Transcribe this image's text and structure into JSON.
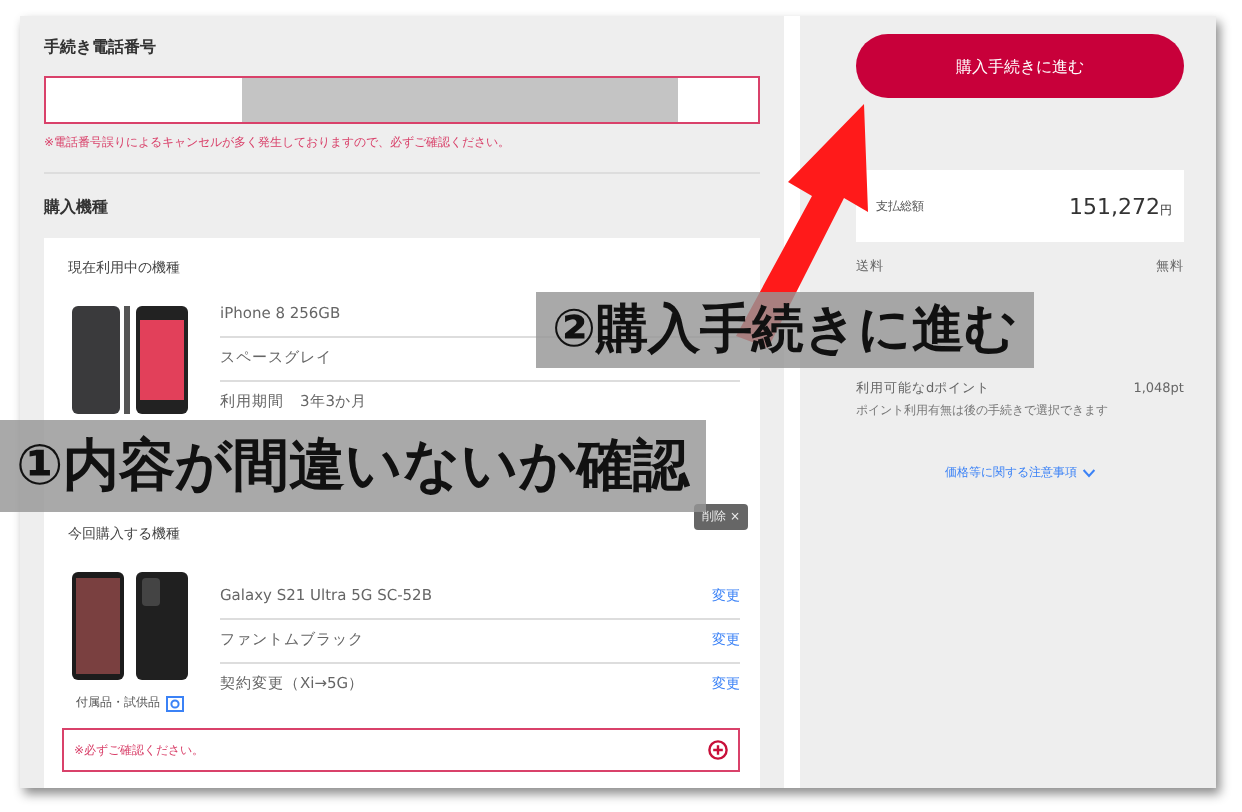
{
  "phone_section": {
    "title": "手続き電話番号",
    "warning": "※電話番号誤りによるキャンセルが多く発生しておりますので、必ずご確認ください。"
  },
  "device_section": {
    "title": "購入機種",
    "current": {
      "title": "現在利用中の機種",
      "specs": [
        "iPhone 8 256GB",
        "スペースグレイ",
        "利用期間　3年3か月"
      ]
    },
    "new": {
      "title": "今回購入する機種",
      "remove": "削除 ×",
      "specs": [
        {
          "text": "Galaxy S21 Ultra 5G SC-52B",
          "action": "変更"
        },
        {
          "text": "ファントムブラック",
          "action": "変更"
        },
        {
          "text": "契約変更（Xi→5G）",
          "action": "変更"
        }
      ],
      "accessories": "付属品・試供品",
      "notice": "※必ずご確認ください。"
    }
  },
  "summary": {
    "button": "購入手続きに進む",
    "total_label": "支払総額",
    "total": "151,272",
    "currency": "円",
    "rows": [
      {
        "label": "送料",
        "value": "無料"
      },
      {
        "label": "利用可能なdポイント",
        "value": "1,048pt"
      }
    ],
    "points_note": "ポイント利用有無は後の手続きで選択できます",
    "notes_link": "価格等に関する注意事項"
  },
  "annotations": [
    {
      "text": "①内容が間違いないか確認"
    },
    {
      "text": "②購入手続きに進む"
    }
  ]
}
